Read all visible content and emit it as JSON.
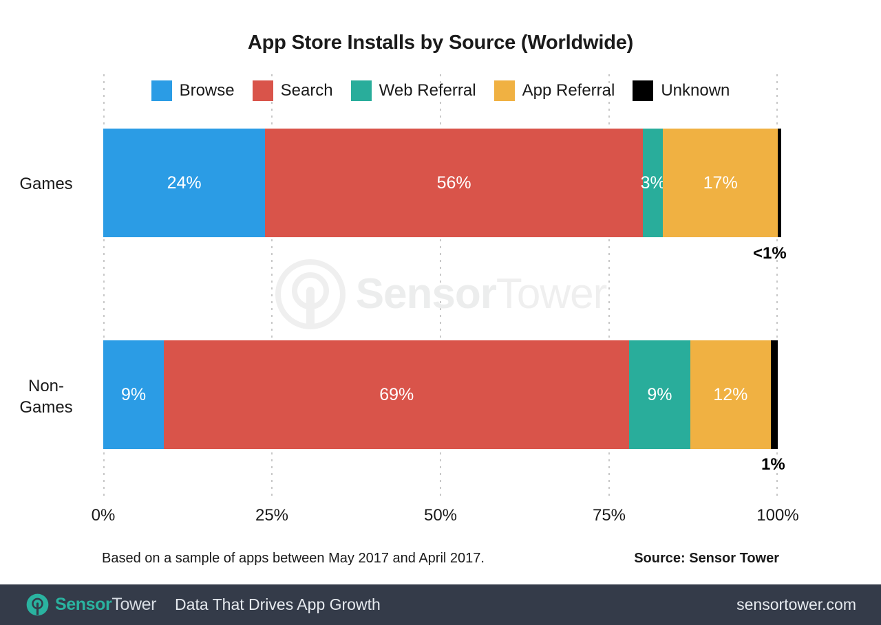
{
  "chart_data": {
    "type": "bar",
    "orientation": "horizontal",
    "stacked": true,
    "normalized_percent": true,
    "title": "App Store Installs by Source (Worldwide)",
    "xlabel": "",
    "ylabel": "",
    "xlim": [
      0,
      100
    ],
    "xticks": [
      "0%",
      "25%",
      "50%",
      "75%",
      "100%"
    ],
    "xtick_values": [
      0,
      25,
      50,
      75,
      100
    ],
    "grid": "vertical-dotted",
    "legend_position": "top-center",
    "categories": [
      "Games",
      "Non-Games"
    ],
    "series": [
      {
        "name": "Browse",
        "color": "#2b9ce5",
        "values": [
          24,
          9
        ],
        "labels": [
          "24%",
          "9%"
        ]
      },
      {
        "name": "Search",
        "color": "#d9544a",
        "values": [
          56,
          69
        ],
        "labels": [
          "56%",
          "69%"
        ]
      },
      {
        "name": "Web Referral",
        "color": "#29ad9b",
        "values": [
          3,
          9
        ],
        "labels": [
          "3%",
          "9%"
        ]
      },
      {
        "name": "App Referral",
        "color": "#f0b142",
        "values": [
          17,
          12
        ],
        "labels": [
          "17%",
          "12%"
        ]
      },
      {
        "name": "Unknown",
        "color": "#000000",
        "values": [
          0.4,
          1
        ],
        "labels": [
          "<1%",
          "1%"
        ]
      }
    ],
    "outside_labels": [
      "<1%",
      "1%"
    ],
    "footnote": "Based on a sample of apps between May 2017 and April 2017.",
    "source": "Source: Sensor Tower"
  },
  "watermark": {
    "brand_primary": "Sensor",
    "brand_secondary": "Tower",
    "icon": "sensor-tower-logo-icon"
  },
  "footer": {
    "brand_primary": "Sensor",
    "brand_secondary": "Tower",
    "tagline": "Data That Drives App Growth",
    "url": "sensortower.com",
    "background": "#343b49",
    "logo_icon": "sensor-tower-logo-icon"
  }
}
